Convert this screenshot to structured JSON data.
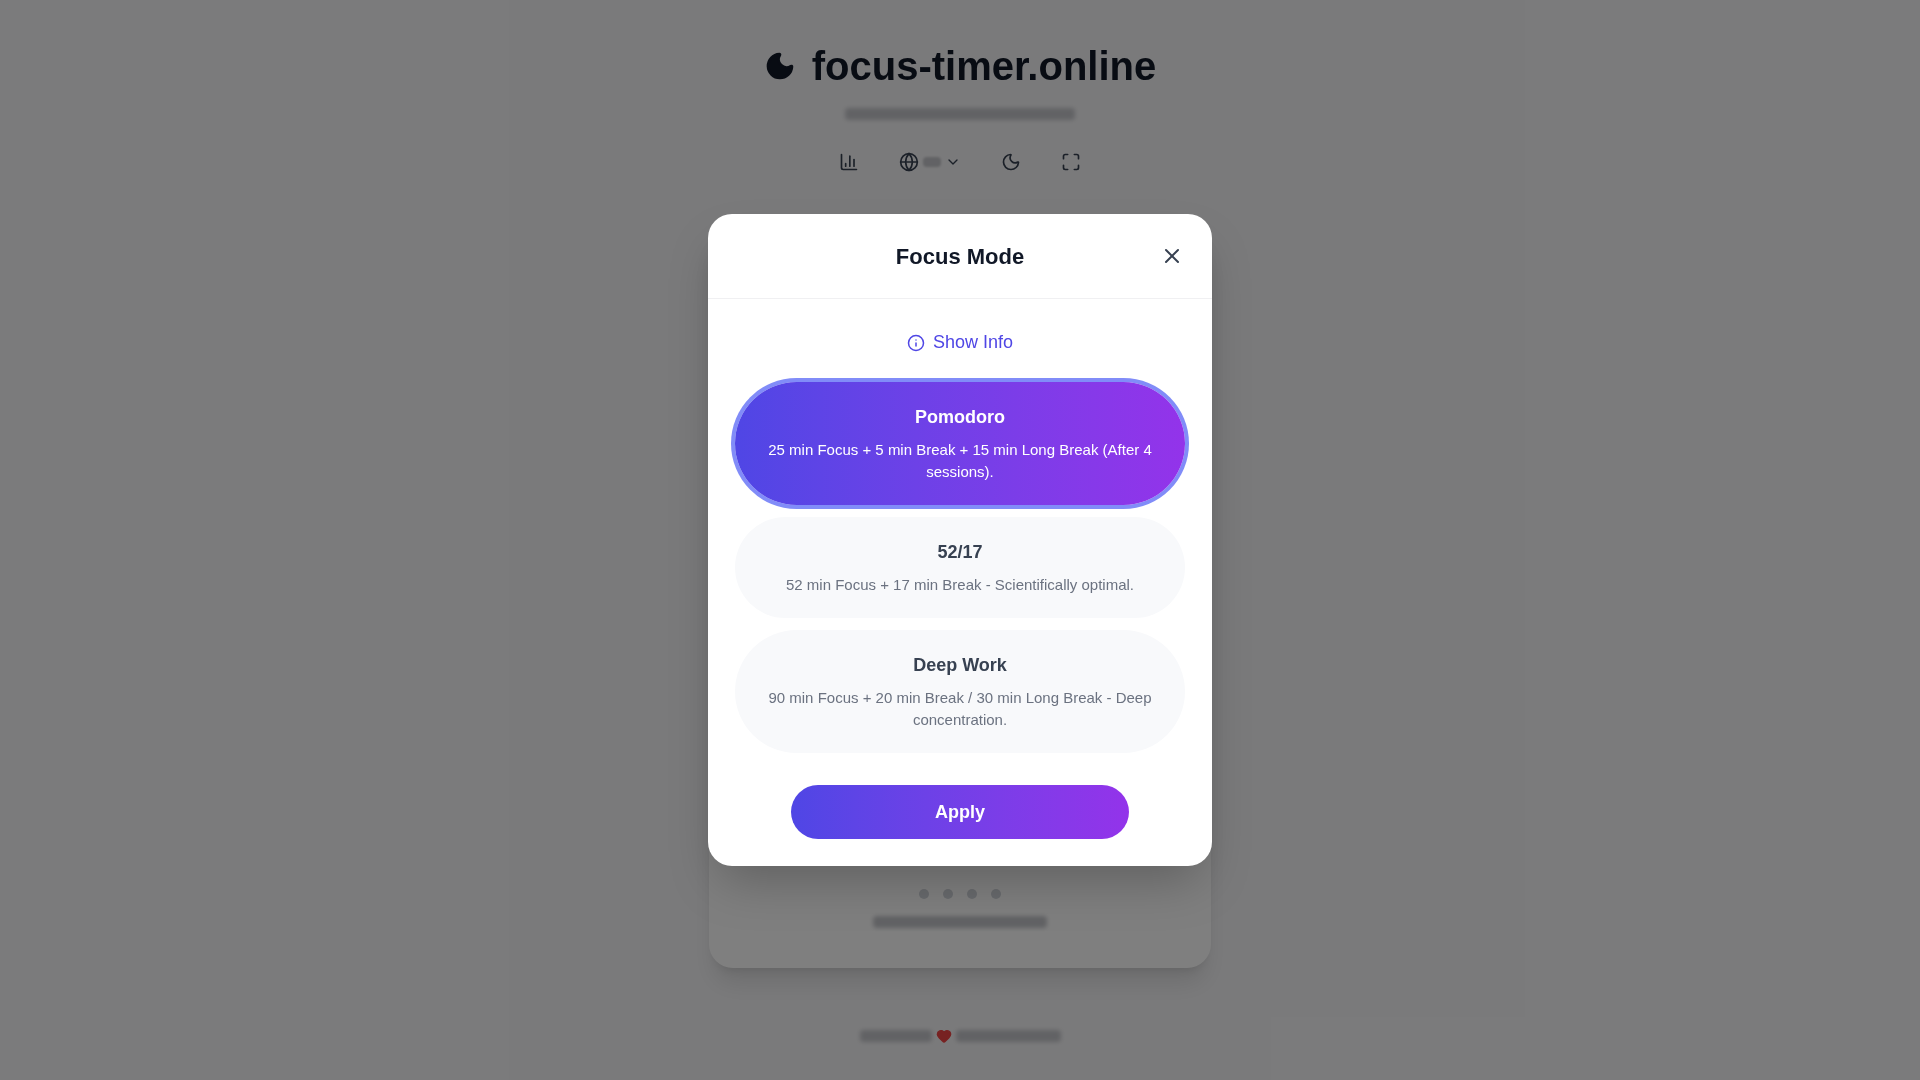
{
  "page": {
    "logo": "focus-timer.online"
  },
  "dialog": {
    "title": "Focus Mode",
    "info_link": "Show Info",
    "modes": [
      {
        "name": "Pomodoro",
        "description": "25 min Focus + 5 min Break + 15 min Long Break (After 4 sessions).",
        "selected": true
      },
      {
        "name": "52/17",
        "description": "52 min Focus + 17 min Break - Scientifically optimal.",
        "selected": false
      },
      {
        "name": "Deep Work",
        "description": "90 min Focus + 20 min Break / 30 min Long Break - Deep concentration.",
        "selected": false
      }
    ],
    "apply": "Apply"
  }
}
